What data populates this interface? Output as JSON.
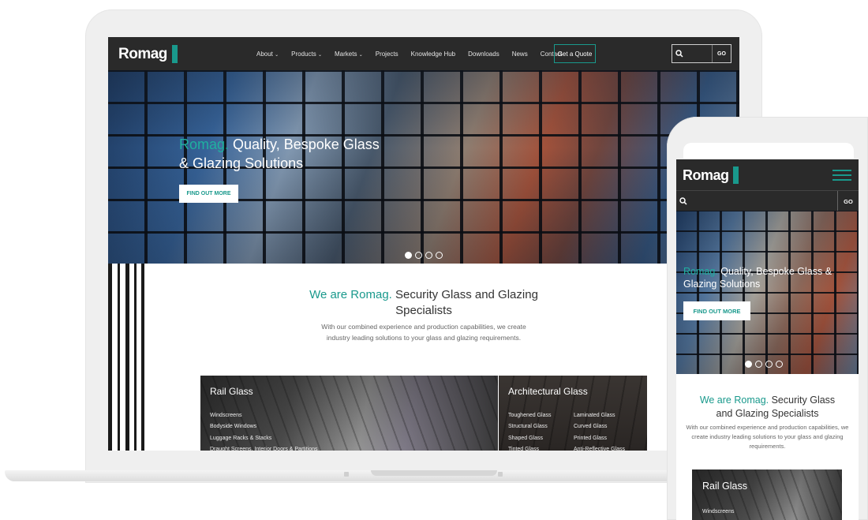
{
  "brand": {
    "name": "Romag",
    "accent_color": "#19998c",
    "nav_background": "#2a2a2a"
  },
  "desktop": {
    "nav": {
      "items": [
        {
          "label": "About",
          "dropdown": true
        },
        {
          "label": "Products",
          "dropdown": true
        },
        {
          "label": "Markets",
          "dropdown": true
        },
        {
          "label": "Projects",
          "dropdown": false
        },
        {
          "label": "Knowledge Hub",
          "dropdown": false
        },
        {
          "label": "Downloads",
          "dropdown": false
        },
        {
          "label": "News",
          "dropdown": false
        },
        {
          "label": "Contact",
          "dropdown": false
        }
      ],
      "quote_button": "Get a Quote",
      "search": {
        "go_label": "GO"
      }
    },
    "hero": {
      "title_accent": "Romag.",
      "title_rest": " Quality, Bespoke Glass & Glazing Solutions",
      "button": "FIND OUT MORE",
      "slides": 4,
      "active_slide": 1
    },
    "intro": {
      "title_accent": "We are Romag.",
      "title_rest": " Security Glass and Glazing Specialists",
      "text": "With our combined experience and production capabilities, we create industry leading solutions to your glass and glazing requirements."
    },
    "cards": {
      "rail": {
        "title": "Rail Glass",
        "items": [
          "Windscreens",
          "Bodyside Windows",
          "Luggage Racks & Stacks",
          "Draught Screens, Interior Doors & Partitions"
        ]
      },
      "architectural": {
        "title": "Architectural Glass",
        "col1": [
          "Toughened Glass",
          "Structural Glass",
          "Shaped Glass",
          "Tinted Glass"
        ],
        "col2": [
          "Laminated Glass",
          "Curved Glass",
          "Printed Glass",
          "Anti-Reflective Glass"
        ]
      }
    }
  },
  "mobile": {
    "search": {
      "go_label": "GO"
    },
    "hero": {
      "title_accent": "Romag.",
      "title_rest": " Quality, Bespoke Glass & Glazing Solutions",
      "button": "FIND OUT MORE",
      "slides": 4,
      "active_slide": 1
    },
    "intro": {
      "title_accent": "We are Romag.",
      "title_rest": " Security Glass and Glazing Specialists",
      "text": "With our combined experience and production capabilities, we create industry leading solutions to your glass and glazing requirements."
    },
    "card": {
      "title": "Rail Glass",
      "first_item": "Windscreens"
    }
  }
}
